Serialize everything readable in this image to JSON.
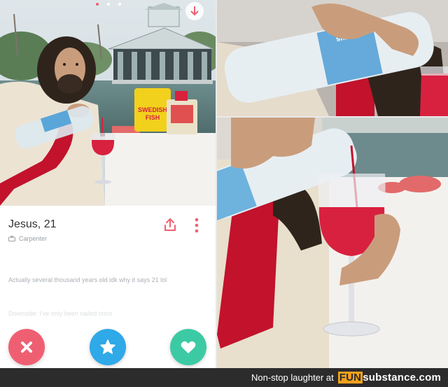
{
  "profile": {
    "name_age": "Jesus, 21",
    "job": "Carpenter",
    "bio": "Actually several thousand years old idk why it says 21 lol",
    "downside": "Downside: I've only been nailed once"
  },
  "actions": {
    "nope": "x-icon",
    "super_like": "star-icon",
    "like": "heart-icon"
  },
  "colors": {
    "nope": "#ef5f72",
    "super_like": "#2fa9e7",
    "like": "#3ccaa4",
    "wine": "#d8213f",
    "sash": "#c2122c"
  },
  "watermark": {
    "text": "Non-stop laughter at",
    "logo_fun": "FUN",
    "logo_rest": "substance.com"
  }
}
